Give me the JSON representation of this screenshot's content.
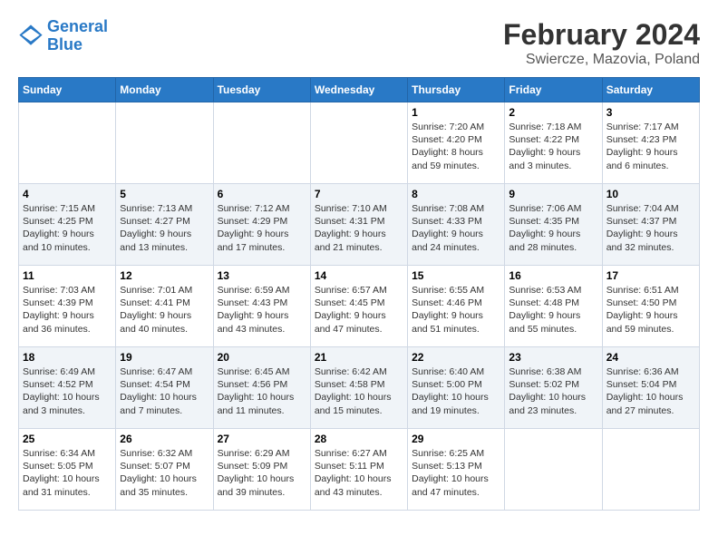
{
  "header": {
    "logo_line1": "General",
    "logo_line2": "Blue",
    "title": "February 2024",
    "subtitle": "Swiercze, Mazovia, Poland"
  },
  "weekdays": [
    "Sunday",
    "Monday",
    "Tuesday",
    "Wednesday",
    "Thursday",
    "Friday",
    "Saturday"
  ],
  "weeks": [
    [
      {
        "day": "",
        "info": ""
      },
      {
        "day": "",
        "info": ""
      },
      {
        "day": "",
        "info": ""
      },
      {
        "day": "",
        "info": ""
      },
      {
        "day": "1",
        "info": "Sunrise: 7:20 AM\nSunset: 4:20 PM\nDaylight: 8 hours\nand 59 minutes."
      },
      {
        "day": "2",
        "info": "Sunrise: 7:18 AM\nSunset: 4:22 PM\nDaylight: 9 hours\nand 3 minutes."
      },
      {
        "day": "3",
        "info": "Sunrise: 7:17 AM\nSunset: 4:23 PM\nDaylight: 9 hours\nand 6 minutes."
      }
    ],
    [
      {
        "day": "4",
        "info": "Sunrise: 7:15 AM\nSunset: 4:25 PM\nDaylight: 9 hours\nand 10 minutes."
      },
      {
        "day": "5",
        "info": "Sunrise: 7:13 AM\nSunset: 4:27 PM\nDaylight: 9 hours\nand 13 minutes."
      },
      {
        "day": "6",
        "info": "Sunrise: 7:12 AM\nSunset: 4:29 PM\nDaylight: 9 hours\nand 17 minutes."
      },
      {
        "day": "7",
        "info": "Sunrise: 7:10 AM\nSunset: 4:31 PM\nDaylight: 9 hours\nand 21 minutes."
      },
      {
        "day": "8",
        "info": "Sunrise: 7:08 AM\nSunset: 4:33 PM\nDaylight: 9 hours\nand 24 minutes."
      },
      {
        "day": "9",
        "info": "Sunrise: 7:06 AM\nSunset: 4:35 PM\nDaylight: 9 hours\nand 28 minutes."
      },
      {
        "day": "10",
        "info": "Sunrise: 7:04 AM\nSunset: 4:37 PM\nDaylight: 9 hours\nand 32 minutes."
      }
    ],
    [
      {
        "day": "11",
        "info": "Sunrise: 7:03 AM\nSunset: 4:39 PM\nDaylight: 9 hours\nand 36 minutes."
      },
      {
        "day": "12",
        "info": "Sunrise: 7:01 AM\nSunset: 4:41 PM\nDaylight: 9 hours\nand 40 minutes."
      },
      {
        "day": "13",
        "info": "Sunrise: 6:59 AM\nSunset: 4:43 PM\nDaylight: 9 hours\nand 43 minutes."
      },
      {
        "day": "14",
        "info": "Sunrise: 6:57 AM\nSunset: 4:45 PM\nDaylight: 9 hours\nand 47 minutes."
      },
      {
        "day": "15",
        "info": "Sunrise: 6:55 AM\nSunset: 4:46 PM\nDaylight: 9 hours\nand 51 minutes."
      },
      {
        "day": "16",
        "info": "Sunrise: 6:53 AM\nSunset: 4:48 PM\nDaylight: 9 hours\nand 55 minutes."
      },
      {
        "day": "17",
        "info": "Sunrise: 6:51 AM\nSunset: 4:50 PM\nDaylight: 9 hours\nand 59 minutes."
      }
    ],
    [
      {
        "day": "18",
        "info": "Sunrise: 6:49 AM\nSunset: 4:52 PM\nDaylight: 10 hours\nand 3 minutes."
      },
      {
        "day": "19",
        "info": "Sunrise: 6:47 AM\nSunset: 4:54 PM\nDaylight: 10 hours\nand 7 minutes."
      },
      {
        "day": "20",
        "info": "Sunrise: 6:45 AM\nSunset: 4:56 PM\nDaylight: 10 hours\nand 11 minutes."
      },
      {
        "day": "21",
        "info": "Sunrise: 6:42 AM\nSunset: 4:58 PM\nDaylight: 10 hours\nand 15 minutes."
      },
      {
        "day": "22",
        "info": "Sunrise: 6:40 AM\nSunset: 5:00 PM\nDaylight: 10 hours\nand 19 minutes."
      },
      {
        "day": "23",
        "info": "Sunrise: 6:38 AM\nSunset: 5:02 PM\nDaylight: 10 hours\nand 23 minutes."
      },
      {
        "day": "24",
        "info": "Sunrise: 6:36 AM\nSunset: 5:04 PM\nDaylight: 10 hours\nand 27 minutes."
      }
    ],
    [
      {
        "day": "25",
        "info": "Sunrise: 6:34 AM\nSunset: 5:05 PM\nDaylight: 10 hours\nand 31 minutes."
      },
      {
        "day": "26",
        "info": "Sunrise: 6:32 AM\nSunset: 5:07 PM\nDaylight: 10 hours\nand 35 minutes."
      },
      {
        "day": "27",
        "info": "Sunrise: 6:29 AM\nSunset: 5:09 PM\nDaylight: 10 hours\nand 39 minutes."
      },
      {
        "day": "28",
        "info": "Sunrise: 6:27 AM\nSunset: 5:11 PM\nDaylight: 10 hours\nand 43 minutes."
      },
      {
        "day": "29",
        "info": "Sunrise: 6:25 AM\nSunset: 5:13 PM\nDaylight: 10 hours\nand 47 minutes."
      },
      {
        "day": "",
        "info": ""
      },
      {
        "day": "",
        "info": ""
      }
    ]
  ]
}
